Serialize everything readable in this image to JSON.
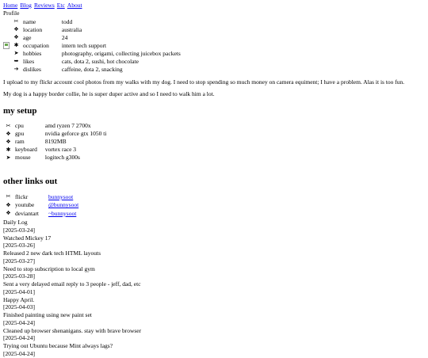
{
  "nav": {
    "links": [
      "Home",
      "Blog",
      "Reviews",
      "Etc",
      "About"
    ]
  },
  "profile": {
    "heading": "Profile",
    "rows": [
      {
        "icon": "scissors-icon",
        "glyph": "✂",
        "key": "name",
        "value": "todd"
      },
      {
        "icon": "four-diamond-icon",
        "glyph": "❖",
        "key": "location",
        "value": "australia"
      },
      {
        "icon": "four-diamond-icon",
        "glyph": "❖",
        "key": "age",
        "value": "24"
      },
      {
        "icon": "star-icon",
        "glyph": "✱",
        "key": "occupation",
        "value": "intern tech support"
      },
      {
        "icon": "arrowhead-icon",
        "glyph": "➤",
        "key": "hobbies",
        "value": "photography, origami, collecting juicebox packets"
      },
      {
        "icon": "arrow-right-icon",
        "glyph": "➥",
        "key": "likes",
        "value": "cats, dota 2, sushi, hot chocolate"
      },
      {
        "icon": "arrow-right-icon",
        "glyph": "➔",
        "key": "dislikes",
        "value": "caffeine, dota 2, snacking"
      }
    ]
  },
  "bio": [
    "I upload to my flickr account cool photos from my walks with my dog. I need to stop spending so much money on camera equiment; I have a problem. Alas it is too fun.",
    "My dog is a happy border collie, he is super duper active and so I need to walk him a lot."
  ],
  "setup": {
    "heading": "my setup",
    "rows": [
      {
        "icon": "scissors-icon",
        "glyph": "✂",
        "key": "cpu",
        "value": "amd ryzen 7 2700x"
      },
      {
        "icon": "four-diamond-icon",
        "glyph": "❖",
        "key": "gpu",
        "value": "nvidia geforce gtx 1050 ti"
      },
      {
        "icon": "four-diamond-icon",
        "glyph": "❖",
        "key": "ram",
        "value": "8192MB"
      },
      {
        "icon": "star-icon",
        "glyph": "✱",
        "key": "keyboard",
        "value": "vortex race 3"
      },
      {
        "icon": "arrowhead-icon",
        "glyph": "➤",
        "key": "mouse",
        "value": "logitech g300s"
      }
    ]
  },
  "links": {
    "heading": "other links out",
    "rows": [
      {
        "icon": "scissors-icon",
        "glyph": "✂",
        "key": "flickr",
        "value": "bunnysoot"
      },
      {
        "icon": "four-diamond-icon",
        "glyph": "❖",
        "key": "youtube",
        "value": "@bunnysoot"
      },
      {
        "icon": "four-diamond-icon",
        "glyph": "❖",
        "key": "deviantart",
        "value": "~bunnysoot"
      }
    ]
  },
  "daily_log": {
    "title": "Daily Log",
    "entries": [
      {
        "date": "[2025-03-24]",
        "text": "Watched Mickey 17"
      },
      {
        "date": "[2025-03-26]",
        "text": "Released 2 new dark tech HTML layouts"
      },
      {
        "date": "[2025-03-27]",
        "text": "Need to stop subscription to local gym"
      },
      {
        "date": "[2025-03-28]",
        "text": "Sent a very delayed email reply to 3 people - jeff, dad, etc"
      },
      {
        "date": "[2025-04-01]",
        "text": "Happy April."
      },
      {
        "date": "[2025-04-03]",
        "text": "Finished painting using new paint set"
      },
      {
        "date": "[2025-04-24]",
        "text": "Cleaned up browser shenanigans. stay with brave browser"
      },
      {
        "date": "[2025-04-24]",
        "text": "Trying out Ubuntu because Mint always lags?"
      },
      {
        "date": "[2025-04-24]",
        "text": ""
      }
    ]
  }
}
